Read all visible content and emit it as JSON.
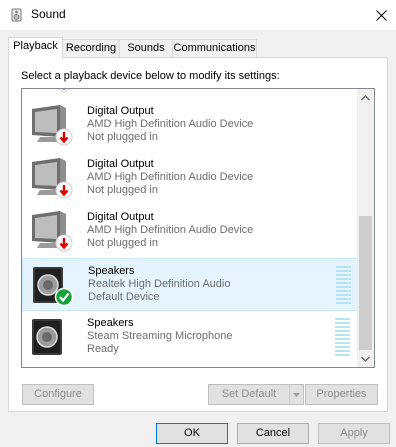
{
  "window": {
    "title": "Sound",
    "icon": "speaker-window-icon"
  },
  "tabs": [
    {
      "label": "Playback",
      "active": true
    },
    {
      "label": "Recording",
      "active": false
    },
    {
      "label": "Sounds",
      "active": false
    },
    {
      "label": "Communications",
      "active": false
    }
  ],
  "instruction": "Select a playback device below to modify its settings:",
  "devices": [
    {
      "name": "Digital Output",
      "description": "AMD High Definition Audio Device",
      "status": "Not plugged in",
      "icon": "monitor-icon",
      "badge": "unplugged-arrow-icon",
      "selected": false
    },
    {
      "name": "Digital Output",
      "description": "AMD High Definition Audio Device",
      "status": "Not plugged in",
      "icon": "monitor-icon",
      "badge": "unplugged-arrow-icon",
      "selected": false
    },
    {
      "name": "Digital Output",
      "description": "AMD High Definition Audio Device",
      "status": "Not plugged in",
      "icon": "monitor-icon",
      "badge": "unplugged-arrow-icon",
      "selected": false
    },
    {
      "name": "Speakers",
      "description": "Realtek High Definition Audio",
      "status": "Default Device",
      "icon": "speaker-icon",
      "badge": "default-check-icon",
      "selected": true
    },
    {
      "name": "Speakers",
      "description": "Steam Streaming Microphone",
      "status": "Ready",
      "icon": "speaker-icon",
      "badge": "",
      "selected": false
    }
  ],
  "buttons": {
    "configure": "Configure",
    "set_default": "Set Default",
    "properties": "Properties",
    "ok": "OK",
    "cancel": "Cancel",
    "apply": "Apply"
  },
  "colors": {
    "accent": "#0078d7",
    "selected_bg": "#e5f3ff",
    "unplugged_badge": "#d80000",
    "default_badge": "#16a23a",
    "meter": "#b7e3ee"
  }
}
